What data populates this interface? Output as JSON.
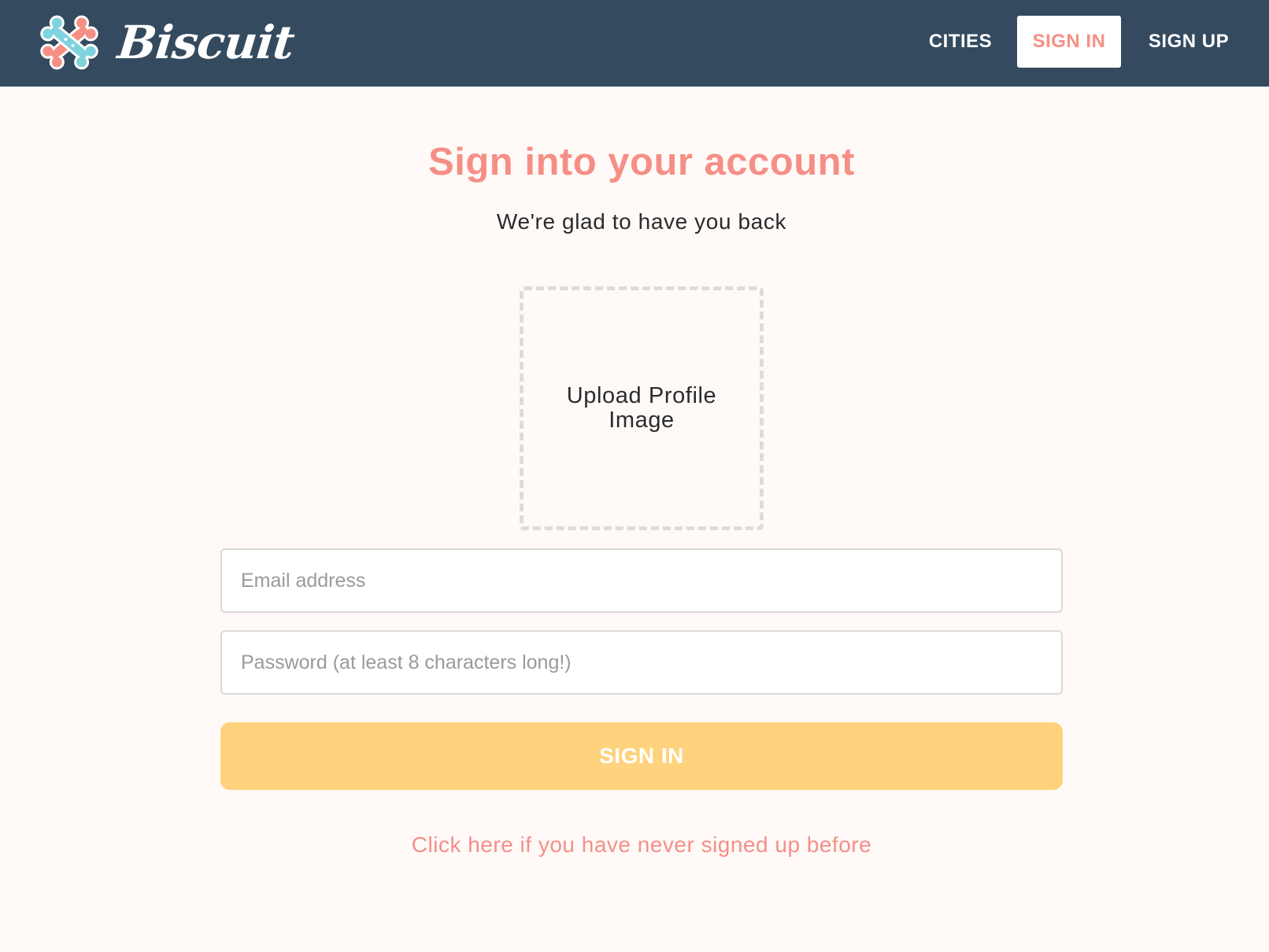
{
  "brand": {
    "name": "Biscuit",
    "colors": {
      "navbar": "#344A5F",
      "accent": "#F58F86",
      "button": "#FFD27D",
      "logo_teal": "#7FD3DC",
      "logo_coral": "#F58F86"
    }
  },
  "nav": {
    "cities_label": "CITIES",
    "signin_label": "SIGN IN",
    "signup_label": "SIGN UP",
    "active": "SIGN IN"
  },
  "main": {
    "title": "Sign into your account",
    "subtitle": "We're glad to have you back",
    "upload_label": "Upload Profile Image",
    "email": {
      "placeholder": "Email address",
      "value": ""
    },
    "password": {
      "placeholder": "Password (at least 8 characters long!)",
      "value": ""
    },
    "submit_label": "SIGN IN",
    "signup_link": "Click here if you have never signed up before"
  }
}
